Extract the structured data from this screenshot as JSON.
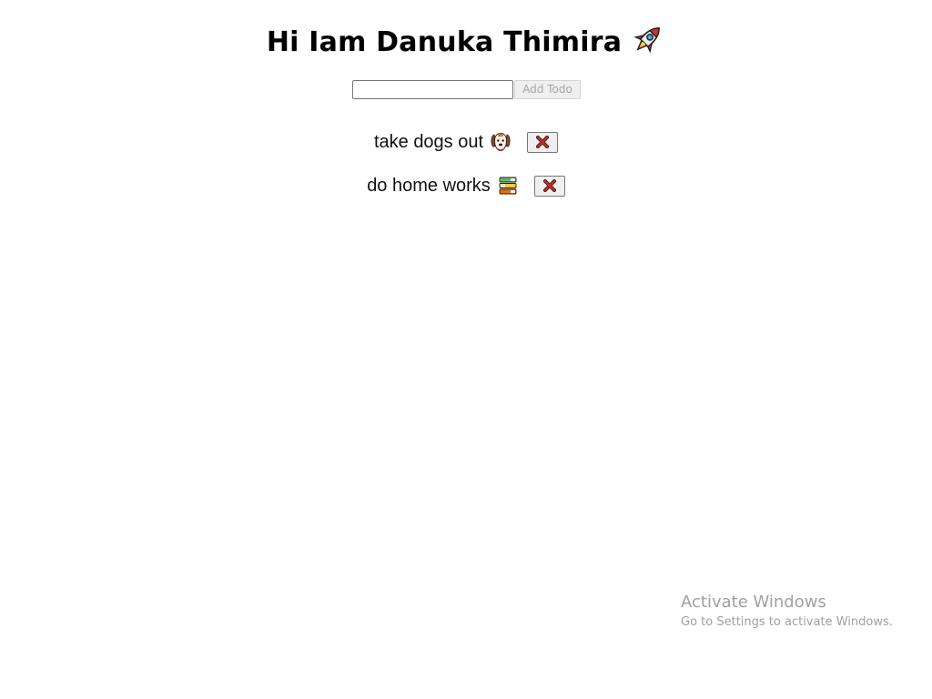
{
  "header": {
    "title": "Hi Iam Danuka Thimira",
    "title_icon": "rocket-icon"
  },
  "add_form": {
    "input_value": "",
    "input_placeholder": "",
    "button_label": "Add Todo"
  },
  "todos": [
    {
      "text": "take dogs out",
      "icon": "dog-face-icon",
      "delete_icon": "red-x-icon"
    },
    {
      "text": "do home works",
      "icon": "books-icon",
      "delete_icon": "red-x-icon"
    }
  ],
  "watermark": {
    "title": "Activate Windows",
    "subtitle": "Go to Settings to activate Windows."
  },
  "colors": {
    "background": "#ffffff",
    "text": "#000000",
    "delete_x": "#c62828",
    "disabled_text": "#a6a6a6",
    "watermark": "#a0a0a0"
  }
}
